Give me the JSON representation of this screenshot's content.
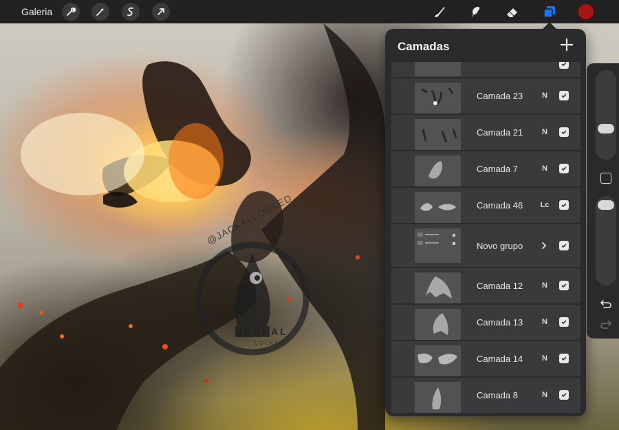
{
  "toolbar": {
    "gallery_label": "Galeria",
    "left_tools": [
      "wrench-icon",
      "magic-wand-icon",
      "selection-icon",
      "transform-arrow-icon"
    ],
    "right_tools": [
      "brush-icon",
      "smudge-icon",
      "eraser-icon",
      "layers-icon"
    ],
    "active_tool": "layers-icon",
    "current_color": "#a71616"
  },
  "canvas": {
    "watermark": {
      "handle": "@JACKALLOCKED",
      "name": "JACKAL",
      "sub": "LOCKED"
    }
  },
  "layers_panel": {
    "title": "Camadas",
    "add_icon": "plus-icon",
    "layers": [
      {
        "name": "Camada 23",
        "blend": "N",
        "visible": true,
        "type": "layer"
      },
      {
        "name": "Camada 21",
        "blend": "N",
        "visible": true,
        "type": "layer"
      },
      {
        "name": "Camada 7",
        "blend": "N",
        "visible": true,
        "type": "layer"
      },
      {
        "name": "Camada 46",
        "blend": "Lc",
        "visible": true,
        "type": "layer"
      },
      {
        "name": "Novo grupo",
        "blend": "",
        "visible": true,
        "type": "group"
      },
      {
        "name": "Camada 12",
        "blend": "N",
        "visible": true,
        "type": "layer"
      },
      {
        "name": "Camada 13",
        "blend": "N",
        "visible": true,
        "type": "layer"
      },
      {
        "name": "Camada 14",
        "blend": "N",
        "visible": true,
        "type": "layer"
      },
      {
        "name": "Camada 8",
        "blend": "N",
        "visible": true,
        "type": "layer"
      }
    ]
  },
  "sidebar": {
    "brush_size_level": 0.35,
    "opacity_level": 1.0,
    "tools": [
      "modify-square-icon",
      "undo-icon",
      "redo-icon"
    ]
  }
}
